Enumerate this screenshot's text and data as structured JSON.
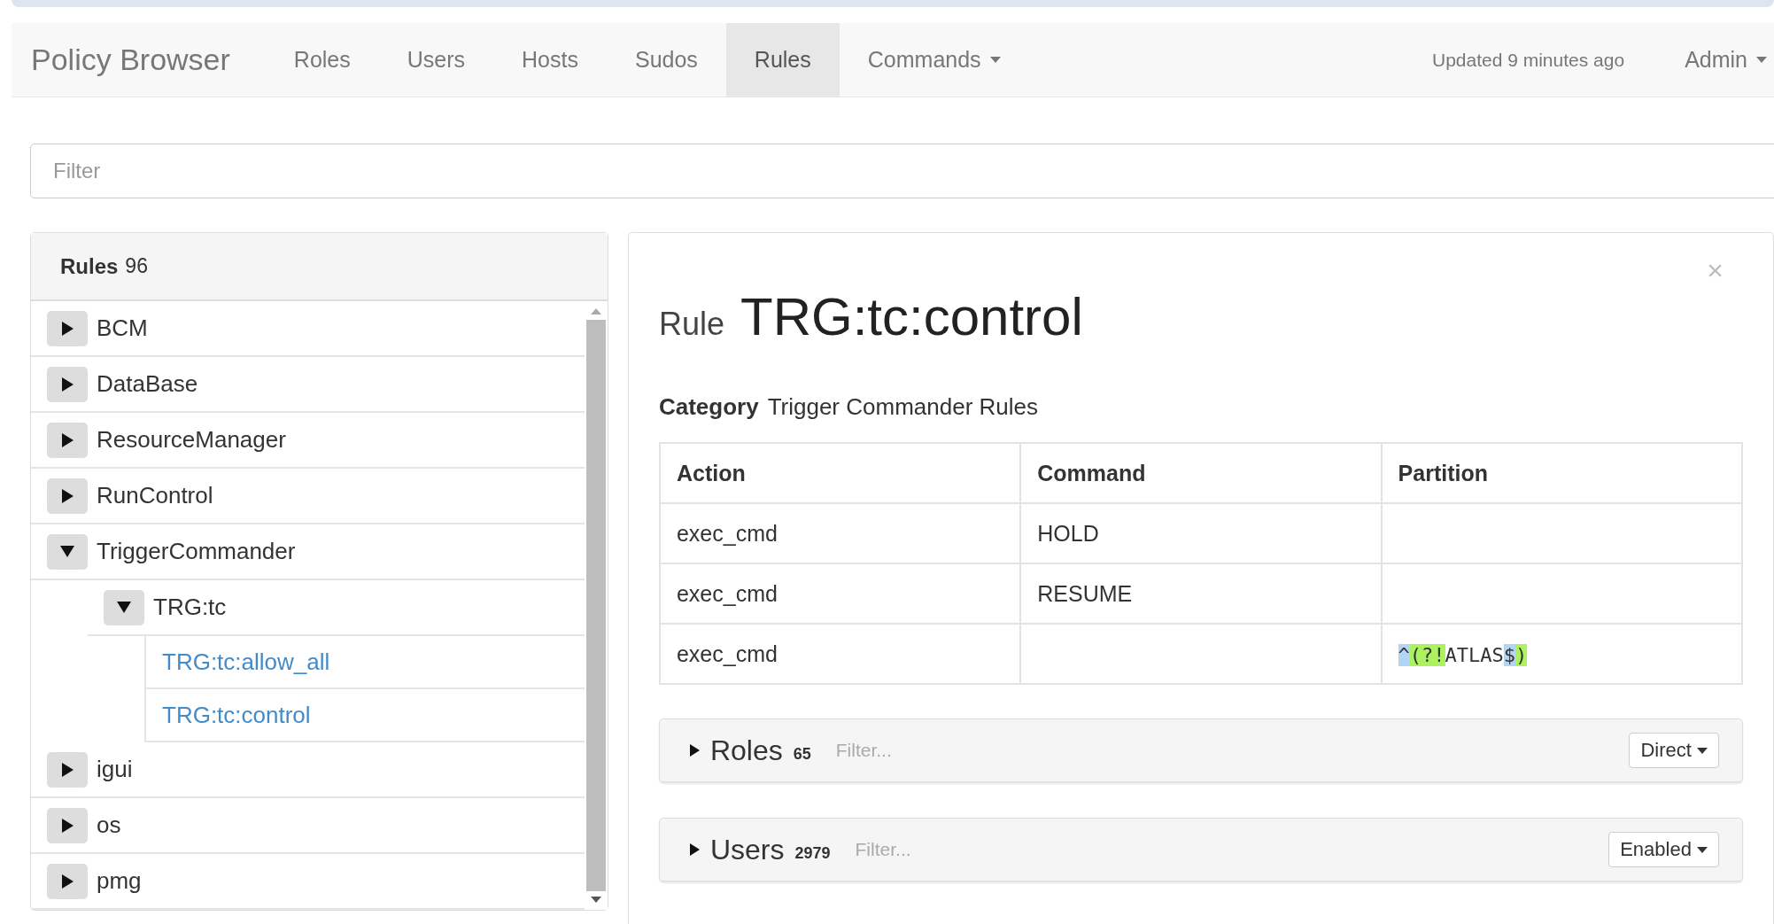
{
  "navbar": {
    "brand": "Policy Browser",
    "items": [
      {
        "label": "Roles",
        "selected": false,
        "kind": "link"
      },
      {
        "label": "Users",
        "selected": false,
        "kind": "link"
      },
      {
        "label": "Hosts",
        "selected": false,
        "kind": "link"
      },
      {
        "label": "Sudos",
        "selected": false,
        "kind": "link"
      },
      {
        "label": "Rules",
        "selected": true,
        "kind": "link"
      },
      {
        "label": "Commands",
        "selected": false,
        "kind": "dropdown"
      }
    ],
    "status": "Updated 9 minutes ago",
    "user_menu": "Admin"
  },
  "filter": {
    "placeholder": "Filter"
  },
  "rules_panel": {
    "title": "Rules",
    "count": "96",
    "tree": [
      {
        "label": "BCM",
        "kind": "group",
        "expanded": false
      },
      {
        "label": "DataBase",
        "kind": "group",
        "expanded": false
      },
      {
        "label": "ResourceManager",
        "kind": "group",
        "expanded": false
      },
      {
        "label": "RunControl",
        "kind": "group",
        "expanded": false
      },
      {
        "label": "TriggerCommander",
        "kind": "group",
        "expanded": true,
        "children": [
          {
            "label": "TRG:tc",
            "kind": "group",
            "expanded": true,
            "children": [
              {
                "label": "TRG:tc:allow_all",
                "kind": "rule"
              },
              {
                "label": "TRG:tc:control",
                "kind": "rule"
              }
            ]
          }
        ]
      },
      {
        "label": "igui",
        "kind": "group",
        "expanded": false
      },
      {
        "label": "os",
        "kind": "group",
        "expanded": false
      },
      {
        "label": "pmg",
        "kind": "group",
        "expanded": false
      }
    ]
  },
  "detail": {
    "heading_prefix": "Rule",
    "title": "TRG:tc:control",
    "close": "×",
    "category_label": "Category",
    "category": "Trigger Commander Rules",
    "table": {
      "columns": [
        "Action",
        "Command",
        "Partition"
      ],
      "rows": [
        [
          {
            "text": "exec_cmd"
          },
          {
            "text": "HOLD"
          },
          {
            "text": ""
          }
        ],
        [
          {
            "text": "exec_cmd"
          },
          {
            "text": "RESUME"
          },
          {
            "text": ""
          }
        ],
        [
          {
            "text": "exec_cmd"
          },
          {
            "text": ""
          },
          {
            "kind": "regex",
            "segments": [
              {
                "text": "^",
                "color": "#b3d5f5"
              },
              {
                "text": "(?!",
                "color": "#acf25e"
              },
              {
                "text": "ATLAS"
              },
              {
                "text": "$",
                "color": "#b3d5f5"
              },
              {
                "text": ")",
                "color": "#acf25e"
              }
            ]
          }
        ]
      ]
    },
    "sections": [
      {
        "label": "Roles",
        "count": "65",
        "placeholder": "Filter...",
        "dropdown": "Direct",
        "expanded": false
      },
      {
        "label": "Users",
        "count": "2979",
        "placeholder": "Filter...",
        "dropdown": "Enabled",
        "expanded": false
      }
    ]
  }
}
